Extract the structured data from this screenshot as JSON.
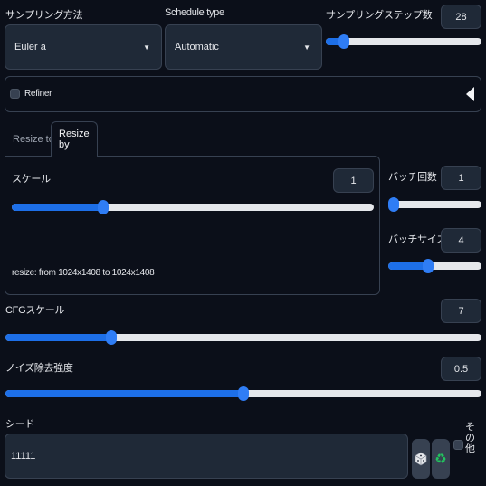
{
  "sampling": {
    "method_label": "サンプリング方法",
    "method_value": "Euler a",
    "schedule_label": "Schedule type",
    "schedule_value": "Automatic",
    "steps_label": "サンプリングステップ数",
    "steps_value": "28",
    "steps_fraction": 0.09
  },
  "refiner": {
    "label": "Refiner"
  },
  "resize": {
    "tabs": [
      {
        "label": "Resize to"
      },
      {
        "label": "Resize by"
      }
    ],
    "scale_label": "スケール",
    "scale_value": "1",
    "scale_fraction": 0.245,
    "info": "resize: from 1024x1408 to 1024x1408"
  },
  "batch": {
    "count_label": "バッチ回数",
    "count_value": "1",
    "count_fraction": 0.0,
    "size_label": "バッチサイズ",
    "size_value": "4",
    "size_fraction": 0.42
  },
  "cfg": {
    "label": "CFGスケール",
    "value": "7",
    "fraction": 0.215
  },
  "denoise": {
    "label": "ノイズ除去強度",
    "value": "0.5",
    "fraction": 0.5
  },
  "seed": {
    "label": "シード",
    "value": "11111",
    "extra_label": "その他",
    "dice_icon": "dice-icon",
    "recycle_icon": "recycle-icon"
  },
  "colors": {
    "accent": "#1d6fe8",
    "thumb": "#2f7df5",
    "background": "#0b0f19",
    "panel": "#1f2937",
    "border": "#374151",
    "recycle": "#22c55e"
  }
}
